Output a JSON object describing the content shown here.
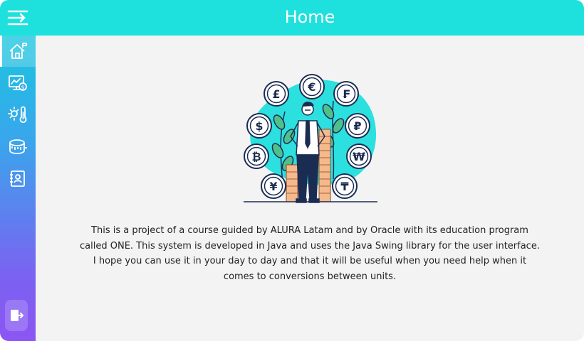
{
  "app": {
    "title": "Home"
  },
  "header": {
    "menu_icon": "menu-arrow-icon",
    "accent_color": "#1ee0dc"
  },
  "sidebar": {
    "items": [
      {
        "icon": "home-icon",
        "label": "Home",
        "active": true
      },
      {
        "icon": "currency-exchange-icon",
        "label": "Currency",
        "active": false
      },
      {
        "icon": "temperature-icon",
        "label": "Temperature",
        "active": false
      },
      {
        "icon": "tape-measure-icon",
        "label": "Measures",
        "active": false
      },
      {
        "icon": "about-icon",
        "label": "About",
        "active": false
      }
    ],
    "exit_icon": "exit-icon",
    "gradient": [
      "#1ac6df",
      "#8c55f3"
    ]
  },
  "main": {
    "illustration": "man-with-currency-coins-illustration",
    "currency_symbols": [
      "£",
      "€",
      "₣",
      "$",
      "₽",
      "₿",
      "₩",
      "¥",
      "₸"
    ],
    "description_lines": [
      "This is a project of a course guided by ALURA Latam and by Oracle with its education program",
      "called ONE. This system is developed in Java and uses the Java Swing library for the user interface.",
      "I hope you can use it in your day to day and that it will be useful when you need help when it",
      "comes to conversions between units."
    ]
  }
}
